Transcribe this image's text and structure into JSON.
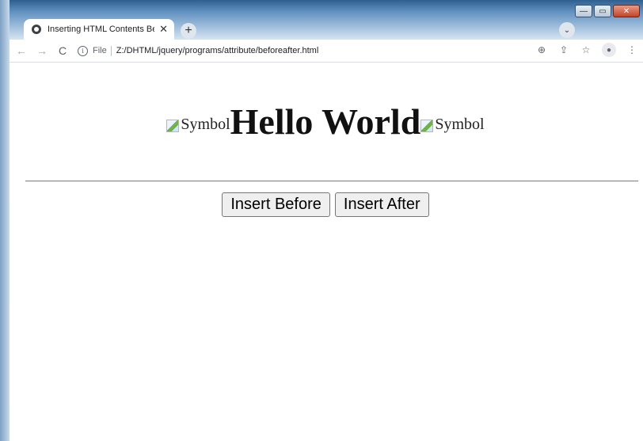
{
  "window": {
    "minimize_symbol": "—",
    "maximize_symbol": "▭",
    "close_symbol": "✕"
  },
  "tab": {
    "title": "Inserting HTML Contents Before",
    "close_symbol": "✕",
    "new_tab_symbol": "+",
    "tab_search_symbol": "⌄"
  },
  "toolbar": {
    "back_symbol": "←",
    "forward_symbol": "→",
    "reload_symbol": "C",
    "info_symbol": "i",
    "scheme_label": "File",
    "url": "Z:/DHTML/jquery/programs/attribute/beforeafter.html",
    "zoom_symbol": "⊕",
    "share_symbol": "⇪",
    "bookmark_symbol": "☆",
    "profile_symbol": "●",
    "menu_symbol": "⋮"
  },
  "page": {
    "left_image_alt": "Symbol",
    "heading": "Hello World",
    "right_image_alt": "Symbol",
    "insert_before_label": "Insert Before",
    "insert_after_label": "Insert After"
  }
}
